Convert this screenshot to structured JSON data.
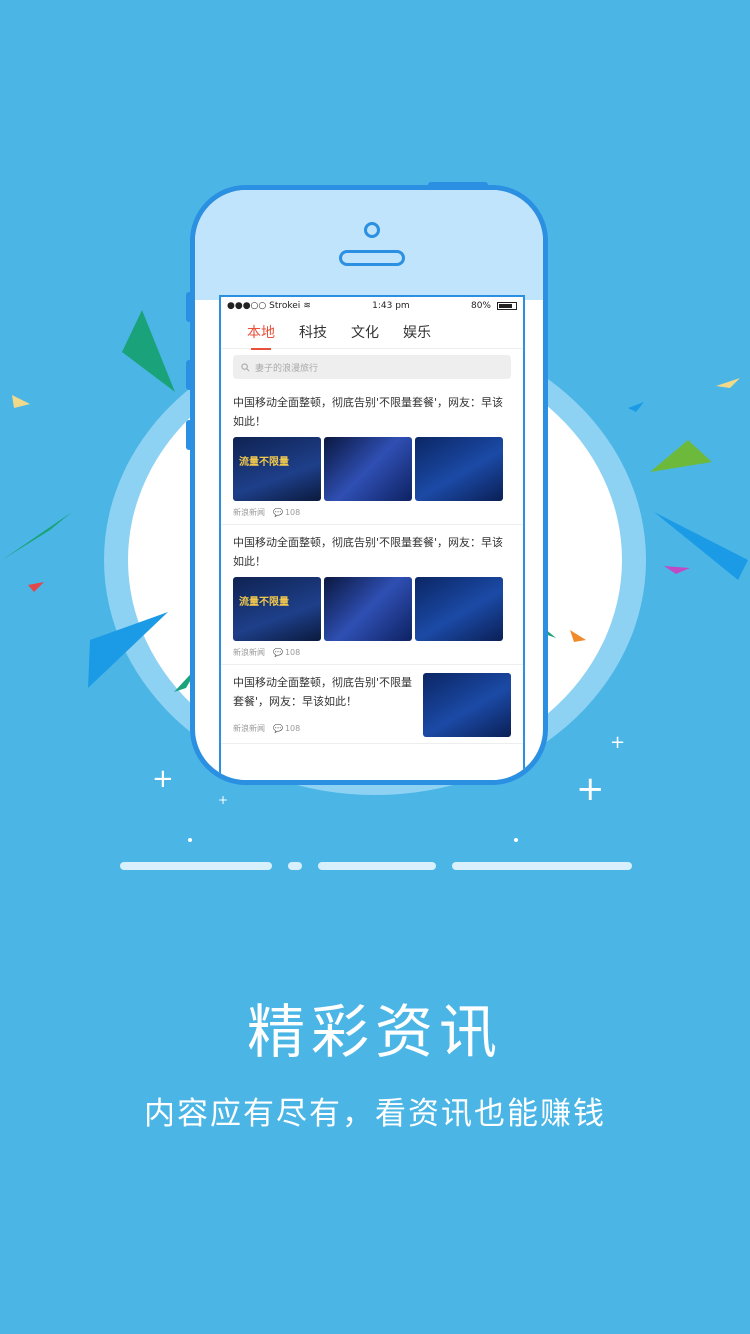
{
  "status_bar": {
    "carrier": "●●●○○ Strokei",
    "time": "1:43 pm",
    "battery": "80%"
  },
  "tabs": [
    "本地",
    "科技",
    "文化",
    "娱乐"
  ],
  "search": {
    "placeholder": "妻子的浪漫旅行"
  },
  "news": [
    {
      "title": "中国移动全面整顿，彻底告别'不限量套餐'，网友：早该如此！",
      "thumb_texts": [
        "流量不限量",
        "",
        ""
      ],
      "source": "新浪新闻",
      "comments": "108"
    },
    {
      "title": "中国移动全面整顿，彻底告别'不限量套餐'，网友：早该如此！",
      "thumb_texts": [
        "流量不限量",
        "",
        ""
      ],
      "source": "新浪新闻",
      "comments": "108"
    },
    {
      "title": "中国移动全面整顿，彻底告别'不限量套餐'，网友：早该如此！",
      "source": "新浪新闻",
      "comments": "108"
    }
  ],
  "headline": "精彩资讯",
  "subline": "内容应有尽有，看资讯也能赚钱",
  "colors": {
    "background": "#4bb6e6",
    "phone_frame": "#2b8fe2",
    "tab_active": "#e8503a"
  }
}
